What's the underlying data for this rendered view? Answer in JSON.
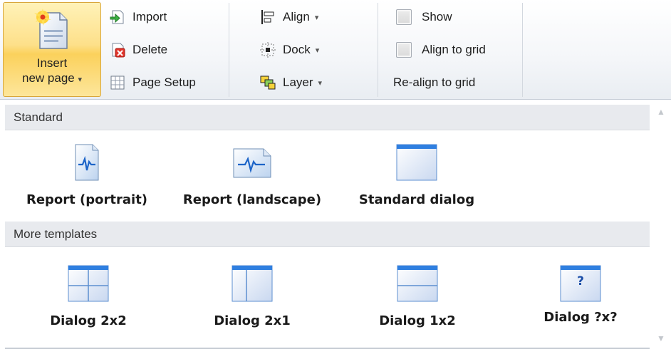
{
  "ribbon": {
    "insert_page": {
      "label_line1": "Insert",
      "label_line2": "new page",
      "caret": "▾",
      "icon": "new-page-icon"
    },
    "page_group": {
      "import": {
        "label": "Import",
        "icon": "import-icon"
      },
      "delete": {
        "label": "Delete",
        "icon": "delete-icon"
      },
      "page_setup": {
        "label": "Page Setup",
        "icon": "page-setup-icon"
      }
    },
    "arrange_group": {
      "align": {
        "label": "Align",
        "caret": "▾",
        "icon": "align-icon"
      },
      "dock": {
        "label": "Dock",
        "caret": "▾",
        "icon": "dock-icon"
      },
      "layer": {
        "label": "Layer",
        "caret": "▾",
        "icon": "layer-icon"
      }
    },
    "grid_group": {
      "show": {
        "label": "Show",
        "checked": false
      },
      "align_to_grid": {
        "label": "Align to grid",
        "checked": false
      },
      "realign": {
        "label": "Re-align to grid"
      }
    }
  },
  "gallery": {
    "categories": [
      {
        "title": "Standard",
        "items": [
          {
            "label": "Report (portrait)",
            "icon": "report-portrait-icon"
          },
          {
            "label": "Report (landscape)",
            "icon": "report-landscape-icon"
          },
          {
            "label": "Standard dialog",
            "icon": "standard-dialog-icon"
          }
        ]
      },
      {
        "title": "More templates",
        "items": [
          {
            "label": "Dialog 2x2",
            "icon": "dialog-2x2-icon"
          },
          {
            "label": "Dialog 2x1",
            "icon": "dialog-2x1-icon"
          },
          {
            "label": "Dialog 1x2",
            "icon": "dialog-1x2-icon"
          },
          {
            "label": "Dialog ?x?",
            "icon": "dialog-custom-icon",
            "glyph": "?"
          }
        ]
      }
    ],
    "scroll_up": "▲",
    "scroll_down": "▼"
  }
}
